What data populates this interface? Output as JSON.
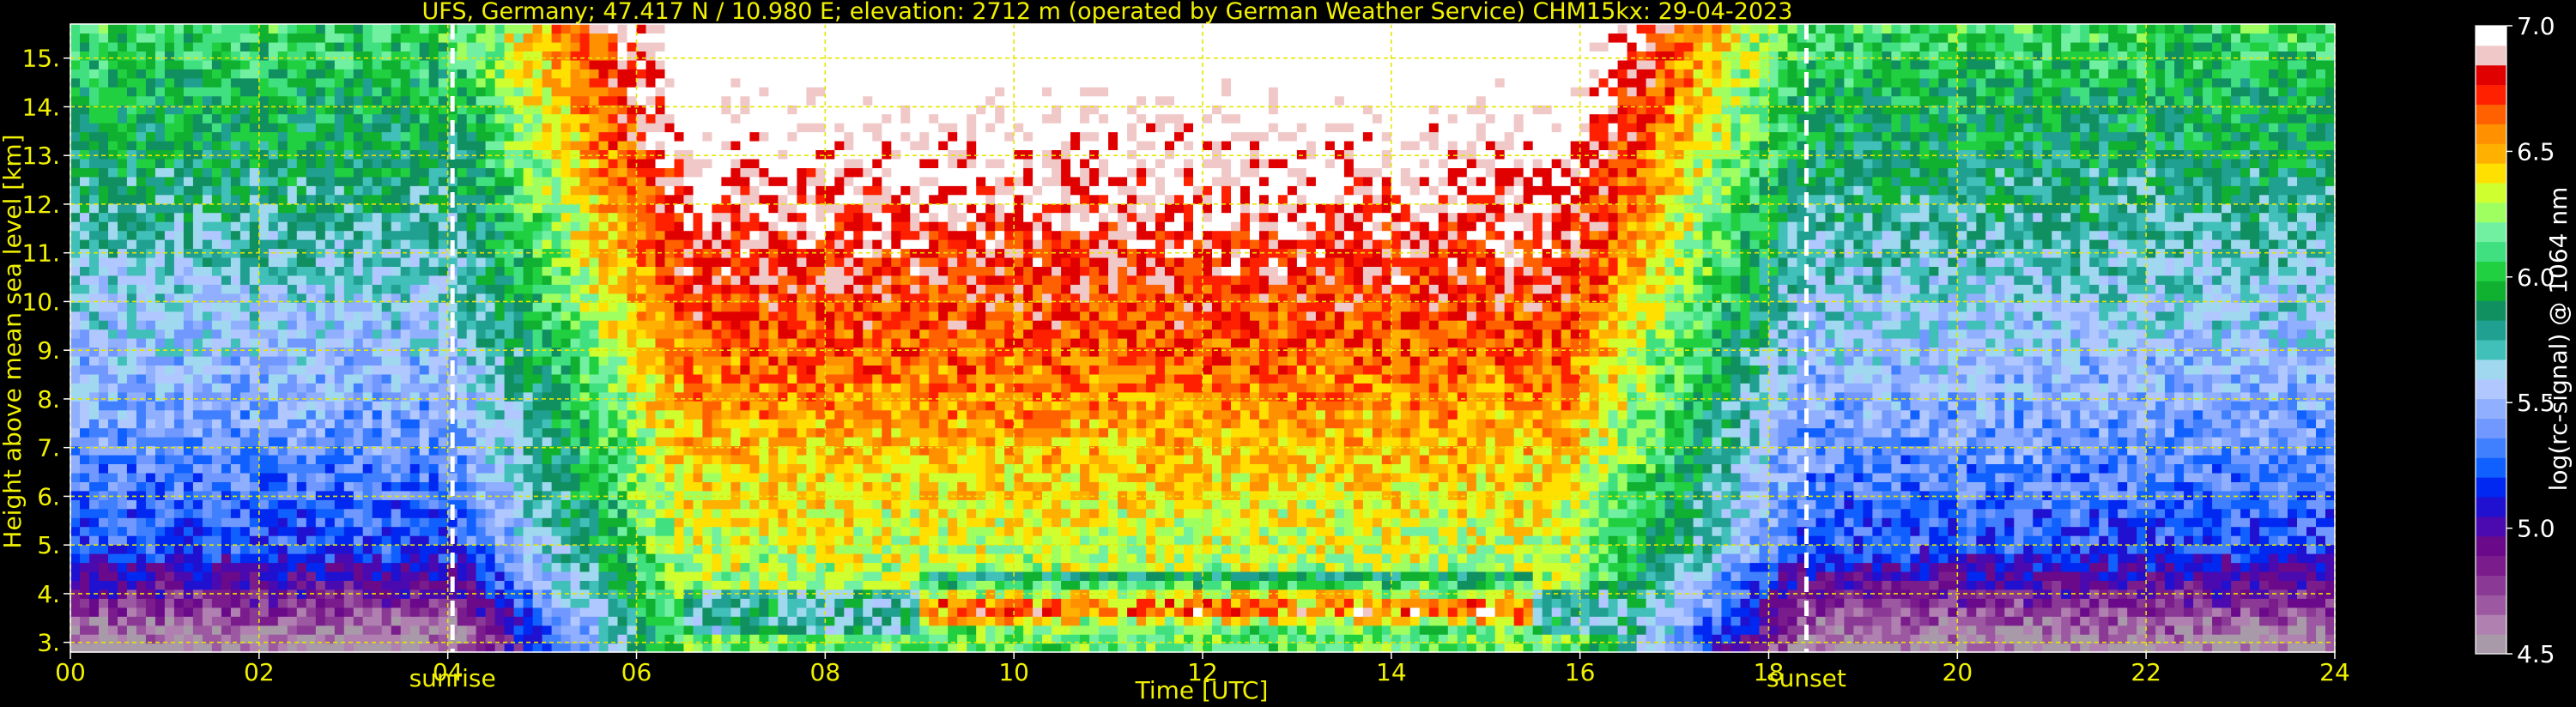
{
  "chart_data": {
    "type": "heatmap",
    "title": "UFS, Germany; 47.417 N / 10.980 E; elevation: 2712 m  (operated by German Weather Service)    CHM15kx: 29-04-2023",
    "xlabel": "Time [UTC]",
    "ylabel": "Height above mean sea level [km]",
    "xlim": [
      0,
      24
    ],
    "ylim": [
      2.8,
      15.7
    ],
    "xticks": [
      0,
      2,
      4,
      6,
      8,
      10,
      12,
      14,
      16,
      18,
      20,
      22,
      24
    ],
    "xtick_labels": [
      "00",
      "02",
      "04",
      "06",
      "08",
      "10",
      "12",
      "14",
      "16",
      "18",
      "20",
      "22",
      "24"
    ],
    "yticks": [
      3,
      4,
      5,
      6,
      7,
      8,
      9,
      10,
      11,
      12,
      13,
      14,
      15
    ],
    "ytick_labels": [
      "3.",
      "4.",
      "5.",
      "6.",
      "7.",
      "8.",
      "9.",
      "10.",
      "11.",
      "12.",
      "13.",
      "14.",
      "15."
    ],
    "grid": true,
    "markers": [
      {
        "x": 4.05,
        "label": "sunrise"
      },
      {
        "x": 18.4,
        "label": "sunset"
      }
    ],
    "colorbar": {
      "label": "log(rc-signal) @ 1064 nm",
      "min": 4.5,
      "max": 7.0,
      "ticks": [
        4.5,
        5.0,
        5.5,
        6.0,
        6.5,
        7.0
      ],
      "tick_labels": [
        "4.5",
        "5.0",
        "5.5",
        "6.0",
        "6.5",
        "7.0"
      ],
      "colors": [
        "#a99aa9",
        "#b080b0",
        "#9c58a0",
        "#8a3a95",
        "#7a1c8c",
        "#6a0a8a",
        "#4a0ab0",
        "#2010d0",
        "#0028f0",
        "#1060ff",
        "#4080ff",
        "#7098ff",
        "#90b0ff",
        "#b0c8ff",
        "#a0d8f0",
        "#40c0b8",
        "#20a090",
        "#109060",
        "#10b030",
        "#20d040",
        "#40e080",
        "#70f0a0",
        "#a0ff60",
        "#d0ff30",
        "#ffe000",
        "#ffb000",
        "#ff9000",
        "#ff6000",
        "#ff2000",
        "#e00000",
        "#f0c8c8",
        "#ffffff"
      ]
    },
    "cloud_layer": {
      "x_range": [
        9.0,
        15.5
      ],
      "y_range": [
        3.1,
        4.4
      ],
      "peak_value": 7.0
    },
    "aerosol_layer": {
      "x_range": [
        6.5,
        16.5
      ],
      "y_range": [
        3.1,
        4.0
      ],
      "value": 5.6
    },
    "night_background_value": 5.3,
    "day_background_value": 6.4
  }
}
